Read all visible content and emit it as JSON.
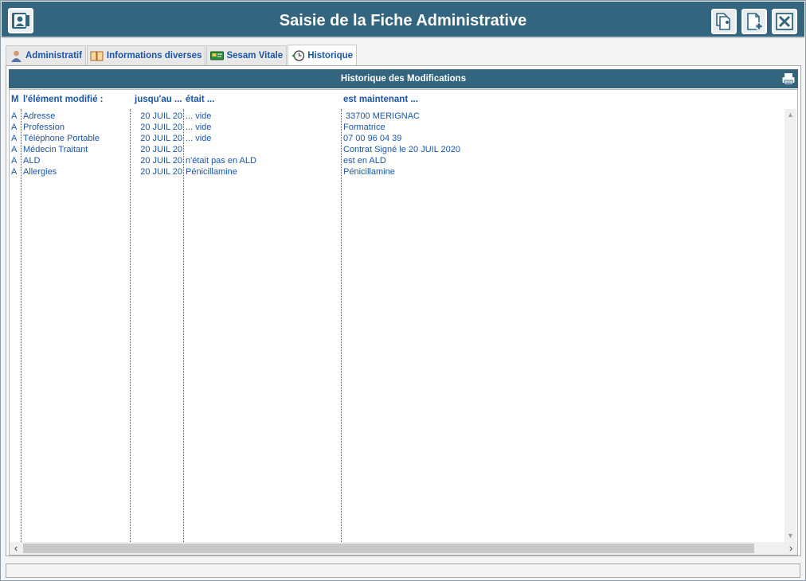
{
  "window": {
    "title": "Saisie de la Fiche Administrative"
  },
  "toolbar": {
    "icons": [
      "copy-add-icon",
      "new-document-icon",
      "close-icon"
    ]
  },
  "tabs": [
    {
      "label": "Administratif",
      "icon": "person-icon",
      "active": false
    },
    {
      "label": "Informations diverses",
      "icon": "book-icon",
      "active": false
    },
    {
      "label": "Sesam Vitale",
      "icon": "card-icon",
      "active": false
    },
    {
      "label": "Historique",
      "icon": "history-icon",
      "active": true
    }
  ],
  "panel": {
    "title": "Historique des Modifications"
  },
  "table": {
    "columns": [
      "M",
      "l'élément modifié :",
      "jusqu'au ...",
      "était ...",
      "est maintenant ..."
    ],
    "rows": [
      {
        "m": "A",
        "element": "Adresse",
        "date": "20 JUIL 20",
        "before": "... vide",
        "after": " 33700 MERIGNAC"
      },
      {
        "m": "A",
        "element": "Profession",
        "date": "20 JUIL 20",
        "before": "... vide",
        "after": "Formatrice"
      },
      {
        "m": "A",
        "element": "Téléphone Portable",
        "date": "20 JUIL 20",
        "before": "... vide",
        "after": "07 00 96 04 39"
      },
      {
        "m": "A",
        "element": "Médecin Traitant",
        "date": "20 JUIL 20",
        "before": "",
        "after": "Contrat Signé le 20 JUIL 2020"
      },
      {
        "m": "A",
        "element": "ALD",
        "date": "20 JUIL 20",
        "before": "n'était pas en ALD",
        "after": "est en ALD"
      },
      {
        "m": "A",
        "element": "Allergies",
        "date": "20 JUIL 20",
        "before": "Pénicillamine",
        "after": "Pénicillamine"
      }
    ]
  },
  "colors": {
    "header_bg": "#33657f",
    "text": "#1a56a8"
  }
}
